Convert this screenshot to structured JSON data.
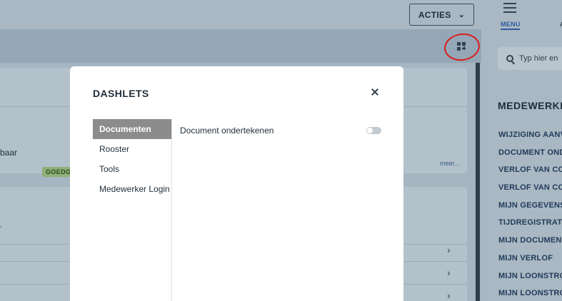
{
  "toolbar": {
    "acties_label": "ACTIES"
  },
  "background": {
    "card1_text": "baar",
    "badge": "GOEDG",
    "more_link": "meer..."
  },
  "sidebar": {
    "menu_label": "MENU",
    "tab2_label": "A",
    "search_placeholder": "Typ hier en",
    "section_title": "MEDEWERKER",
    "items": [
      "WIJZIGING AANV",
      "DOCUMENT OND",
      "VERLOF VAN COL",
      "VERLOF VAN COL",
      "MIJN GEGEVENS",
      "TIJDREGISTRATI",
      "MIJN DOCUMENT",
      "MIJN VERLOF",
      "MIJN LOONSTRO",
      "MIJN LOONSTRO"
    ]
  },
  "modal": {
    "title": "DASHLETS",
    "tabs": [
      {
        "label": "Documenten",
        "active": true
      },
      {
        "label": "Rooster",
        "active": false
      },
      {
        "label": "Tools",
        "active": false
      },
      {
        "label": "Medewerker Login",
        "active": false
      }
    ],
    "options": [
      {
        "label": "Document ondertekenen",
        "enabled": false
      }
    ]
  },
  "colors": {
    "accent": "#2e5a9c",
    "active_tab": "#8c8c8c",
    "annotation_circle": "#d91e1e"
  }
}
